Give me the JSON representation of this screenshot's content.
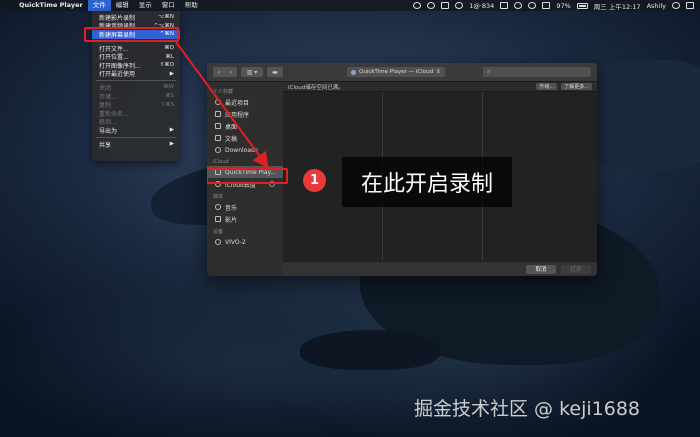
{
  "menubar": {
    "apple": "",
    "app_name": "QuickTime Player",
    "items": [
      "文件",
      "编辑",
      "显示",
      "窗口",
      "帮助"
    ],
    "status": {
      "wechat_count": "1@·834",
      "battery": "97%",
      "clock": "周三 上午12:17",
      "user": "Ashily"
    }
  },
  "file_menu": {
    "items": [
      {
        "label": "新建影片录制",
        "shortcut": "⌥⌘N",
        "state": "normal"
      },
      {
        "label": "新建音频录制",
        "shortcut": "^⌥⌘N",
        "state": "normal"
      },
      {
        "label": "新建屏幕录制",
        "shortcut": "^⌘N",
        "state": "selected"
      },
      {
        "label": "打开文件...",
        "shortcut": "⌘O",
        "state": "normal"
      },
      {
        "label": "打开位置...",
        "shortcut": "⌘L",
        "state": "normal"
      },
      {
        "label": "打开图像序列...",
        "shortcut": "⇧⌘O",
        "state": "normal"
      },
      {
        "label": "打开最近使用",
        "shortcut": "▶",
        "state": "normal"
      },
      {
        "label": "关闭",
        "shortcut": "⌘W",
        "state": "disabled"
      },
      {
        "label": "存储...",
        "shortcut": "⌘S",
        "state": "disabled"
      },
      {
        "label": "复制",
        "shortcut": "⇧⌘S",
        "state": "disabled"
      },
      {
        "label": "重新命名...",
        "shortcut": "",
        "state": "disabled"
      },
      {
        "label": "移到...",
        "shortcut": "",
        "state": "disabled"
      },
      {
        "label": "导出为",
        "shortcut": "▶",
        "state": "normal"
      },
      {
        "label": "共享",
        "shortcut": "▶",
        "state": "normal"
      }
    ]
  },
  "dialog": {
    "toolbar": {
      "back": "‹",
      "forward": "›",
      "view": "▥ ▾",
      "folder": "▬",
      "location": "QuickTime Player — iCloud",
      "location_arrow": "⇕",
      "search_icon": "⌕"
    },
    "sidebar": {
      "sections": [
        {
          "title": "个人收藏",
          "items": [
            "最近项目",
            "应用程序",
            "桌面",
            "文稿",
            "Downloads"
          ]
        },
        {
          "title": "iCloud",
          "items": [
            "QuickTime Play...",
            "iCloud云盘"
          ]
        },
        {
          "title": "媒体",
          "items": [
            "音乐",
            "影片"
          ]
        },
        {
          "title": "设备",
          "items": [
            "VIVO-2"
          ]
        }
      ]
    },
    "banner": {
      "text": "iCloud储存空间已满。",
      "upgrade": "升级...",
      "learn_more": "了解更多..."
    },
    "footer": {
      "cancel": "取消",
      "open": "打开"
    }
  },
  "annotation": {
    "number": "1",
    "text": "在此开启录制",
    "color": "#e02020"
  },
  "watermark": "掘金技术社区 @ keji1688"
}
